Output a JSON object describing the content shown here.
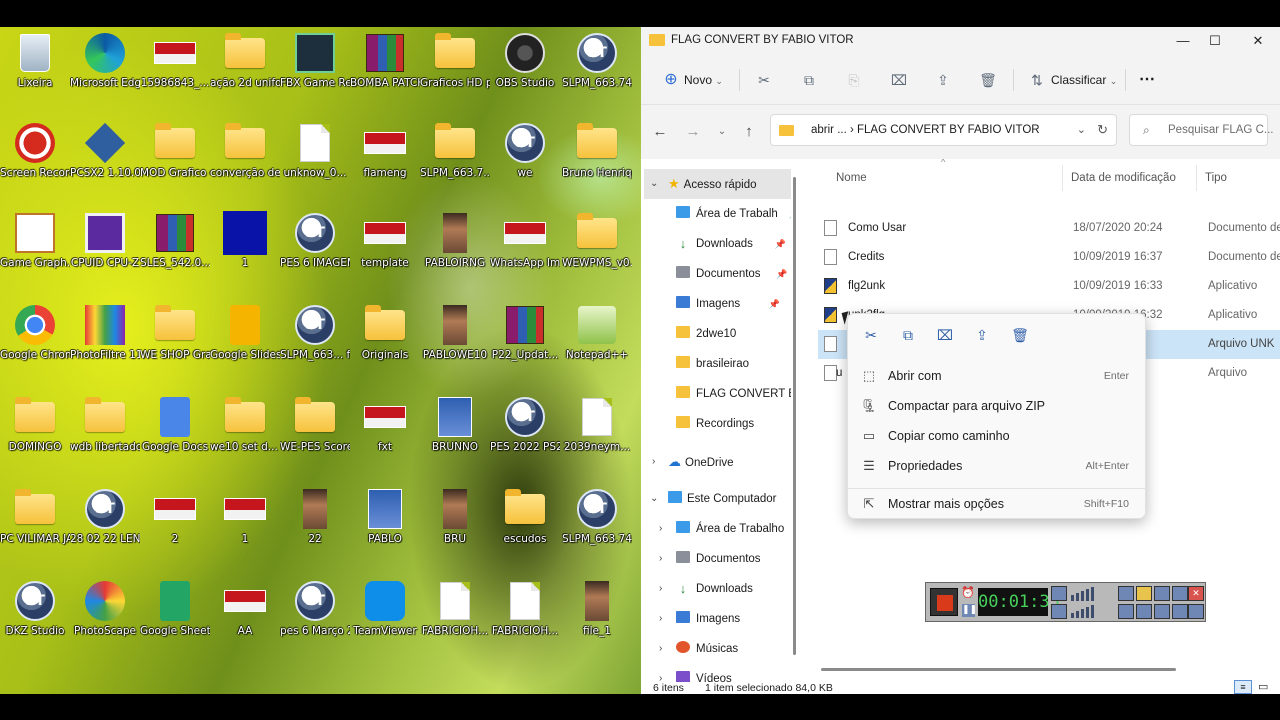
{
  "desktop": {
    "icons": [
      {
        "label": "Lixeira",
        "icon": "recycle-bin-icon"
      },
      {
        "label": "Microsoft Edge",
        "icon": "edge-icon"
      },
      {
        "label": "15986843_...",
        "icon": "image-thumbnail-icon"
      },
      {
        "label": "ação 2d uniforme",
        "icon": "folder-icon"
      },
      {
        "label": "FBX Game Recorder",
        "icon": "fbx-recorder-icon"
      },
      {
        "label": "BOMBA PATCH BE...",
        "icon": "winrar-icon"
      },
      {
        "label": "Graficos HD para tu PES...",
        "icon": "folder-icon"
      },
      {
        "label": "OBS Studio",
        "icon": "obs-icon"
      },
      {
        "label": "SLPM_663.74 BETA ABRI...",
        "icon": "pes-st-icon"
      },
      {
        "label": "Screen Recorder",
        "icon": "screen-recorder-icon"
      },
      {
        "label": "PCSX2 1.10.0",
        "icon": "pcsx2-icon"
      },
      {
        "label": "MOD Grafico eFootball P...",
        "icon": "folder-icon"
      },
      {
        "label": "converção de faces codicos",
        "icon": "folder-icon"
      },
      {
        "label": "unknow_0...",
        "icon": "document-icon"
      },
      {
        "label": "flameng",
        "icon": "image-thumbnail-icon"
      },
      {
        "label": "SLPM_663.7...",
        "icon": "folder-icon"
      },
      {
        "label": "we",
        "icon": "pes-st-icon"
      },
      {
        "label": "Bruno Henrique",
        "icon": "folder-icon"
      },
      {
        "label": "Game Graph...",
        "icon": "game-graph-icon"
      },
      {
        "label": "CPUID CPU-Z",
        "icon": "cpuz-icon"
      },
      {
        "label": "SLES_542.0... andre hen...",
        "icon": "winrar-icon"
      },
      {
        "label": "1",
        "icon": "blue-square-icon"
      },
      {
        "label": "PES 6 IMAGEM",
        "icon": "pes-st-icon"
      },
      {
        "label": "template",
        "icon": "image-thumbnail-icon"
      },
      {
        "label": "PABLOIRNG",
        "icon": "face-image-icon"
      },
      {
        "label": "WhatsApp Image 2022...",
        "icon": "image-thumbnail-icon"
      },
      {
        "label": "WEWPMS_v0.2",
        "icon": "folder-icon"
      },
      {
        "label": "Google Chrome",
        "icon": "chrome-icon"
      },
      {
        "label": "PhotoFiltre 11",
        "icon": "photofiltre-icon"
      },
      {
        "label": "WE SHOP Gratis - lin...",
        "icon": "folder-icon"
      },
      {
        "label": "Google Slides",
        "icon": "google-slides-icon"
      },
      {
        "label": "SLPM_663... fev",
        "icon": "pes-st-icon"
      },
      {
        "label": "Originals",
        "icon": "folder-icon"
      },
      {
        "label": "PABLOWE10",
        "icon": "face-image-icon"
      },
      {
        "label": "P22_Updat...",
        "icon": "winrar-icon"
      },
      {
        "label": "Notepad++",
        "icon": "notepad-plus-icon"
      },
      {
        "label": "DOMINGO",
        "icon": "folder-icon"
      },
      {
        "label": "wdb libertadores",
        "icon": "folder-icon"
      },
      {
        "label": "Google Docs",
        "icon": "google-docs-icon"
      },
      {
        "label": "we10 set d... 5.1.1 e 5.2.0",
        "icon": "folder-icon"
      },
      {
        "label": "WE-PES Scoreboa...",
        "icon": "folder-icon"
      },
      {
        "label": "fxt",
        "icon": "image-thumbnail-icon"
      },
      {
        "label": "BRUNNO",
        "icon": "str-image-icon"
      },
      {
        "label": "PES 2022 PS2 BY VILIMA...",
        "icon": "pes-st-icon"
      },
      {
        "label": "2039neym...",
        "icon": "document-icon"
      },
      {
        "label": "PC VILIMAR JANEIRO",
        "icon": "folder-icon"
      },
      {
        "label": "28 02 22 LENDAS D...",
        "icon": "pes-st-icon"
      },
      {
        "label": "2",
        "icon": "image-thumbnail-icon"
      },
      {
        "label": "1",
        "icon": "image-thumbnail-icon"
      },
      {
        "label": "22",
        "icon": "face-image-icon"
      },
      {
        "label": "PABLO",
        "icon": "str-image-icon"
      },
      {
        "label": "BRU",
        "icon": "face-image-icon"
      },
      {
        "label": "escudos",
        "icon": "folder-icon"
      },
      {
        "label": "SLPM_663.74 MUSICASSS",
        "icon": "pes-st-icon"
      },
      {
        "label": "DKZ Studio",
        "icon": "pes-st-icon"
      },
      {
        "label": "PhotoScape",
        "icon": "photoscape-icon"
      },
      {
        "label": "Google Sheets",
        "icon": "google-sheets-icon"
      },
      {
        "label": "AA",
        "icon": "image-thumbnail-icon"
      },
      {
        "label": "pes 6 Março 2022 ps2",
        "icon": "pes-st-icon"
      },
      {
        "label": "TeamViewer",
        "icon": "teamviewer-icon"
      },
      {
        "label": "FABRICIOH...",
        "icon": "document-icon"
      },
      {
        "label": "FABRICIOH...",
        "icon": "document-icon"
      },
      {
        "label": "file_1",
        "icon": "face-image-icon"
      }
    ]
  },
  "explorer": {
    "title": "FLAG CONVERT BY FABIO VITOR",
    "controls": {
      "minimize": "—",
      "maximize": "☐",
      "close": "✕"
    },
    "toolbar": {
      "new_label": "Novo",
      "sort_label": "Classificar",
      "more": "⋯"
    },
    "address": {
      "path": "abrir ...  ›  FLAG CONVERT BY FABIO VITOR",
      "search_placeholder": "Pesquisar FLAG C..."
    },
    "nav": {
      "quick_access": "Acesso rápido",
      "quick_items": [
        {
          "label": "Área de Trabalh",
          "pinned": true
        },
        {
          "label": "Downloads",
          "pinned": true
        },
        {
          "label": "Documentos",
          "pinned": true
        },
        {
          "label": "Imagens",
          "pinned": true
        },
        {
          "label": "2dwe10",
          "pinned": false
        },
        {
          "label": "brasileirao",
          "pinned": false
        },
        {
          "label": "FLAG CONVERT BY",
          "pinned": false
        },
        {
          "label": "Recordings",
          "pinned": false
        }
      ],
      "onedrive": "OneDrive",
      "this_pc": "Este Computador",
      "pc_items": [
        "Área de Trabalho",
        "Documentos",
        "Downloads",
        "Imagens",
        "Músicas",
        "Vídeos"
      ]
    },
    "columns": {
      "name": "Nome",
      "date": "Data de modificação",
      "type": "Tipo"
    },
    "files": [
      {
        "name": "Como Usar",
        "date": "18/07/2020 20:24",
        "type": "Documento de"
      },
      {
        "name": "Credits",
        "date": "10/09/2019 16:37",
        "type": "Documento de"
      },
      {
        "name": "flg2unk",
        "date": "10/09/2019 16:33",
        "type": "Aplicativo"
      },
      {
        "name": "unk2flg",
        "date": "10/09/2019 16:32",
        "type": "Aplicativo"
      },
      {
        "name": "",
        "date": "",
        "type": "Arquivo UNK"
      },
      {
        "name": "u",
        "date": "",
        "type": "Arquivo"
      }
    ],
    "status": {
      "count": "6 itens",
      "selected": "1 item selecionado  84,0 KB"
    }
  },
  "context_menu": {
    "items": [
      {
        "label": "Abrir com",
        "shortcut": "Enter"
      },
      {
        "label": "Compactar para arquivo ZIP",
        "shortcut": ""
      },
      {
        "label": "Copiar como caminho",
        "shortcut": ""
      },
      {
        "label": "Propriedades",
        "shortcut": "Alt+Enter"
      },
      {
        "label": "Mostrar mais opções",
        "shortcut": "Shift+F10"
      }
    ]
  },
  "recorder": {
    "time": "00:01:35"
  }
}
